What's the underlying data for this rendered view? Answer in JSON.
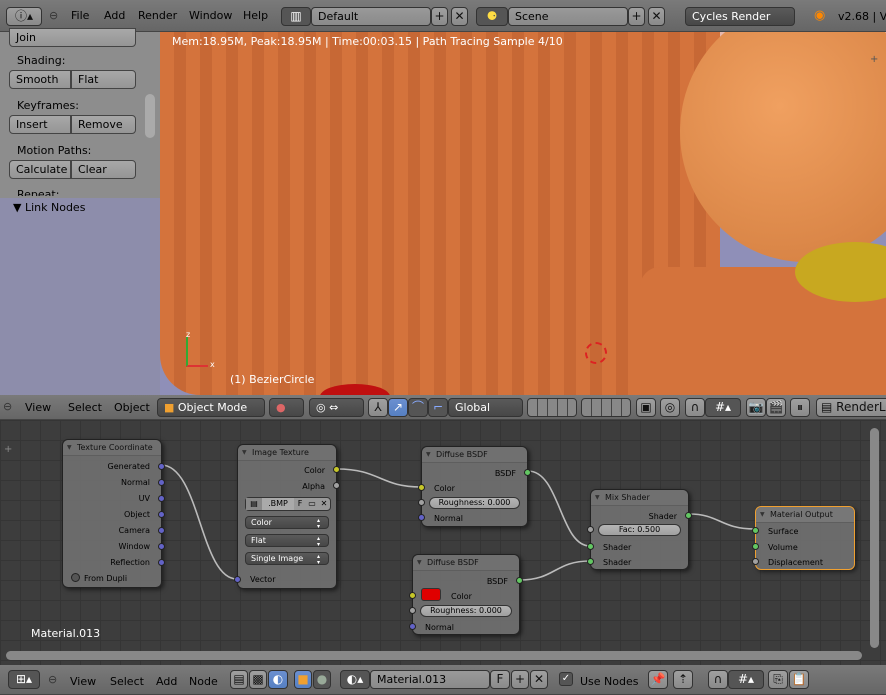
{
  "top_bar": {
    "menus": [
      "File",
      "Add",
      "Render",
      "Window",
      "Help"
    ],
    "layout": "Default",
    "scene": "Scene",
    "engine": "Cycles Render",
    "version": "v2.68 | V"
  },
  "tool_panel": {
    "join": "Join",
    "shading_label": "Shading:",
    "smooth": "Smooth",
    "flat": "Flat",
    "keyframes_label": "Keyframes:",
    "insert": "Insert",
    "remove": "Remove",
    "motion_paths_label": "Motion Paths:",
    "calculate": "Calculate",
    "clear": "Clear",
    "repeat_label": "Repeat:",
    "link_nodes": "Link Nodes"
  },
  "viewport": {
    "stats": "Mem:18.95M, Peak:18.95M | Time:00:03.15 | Path Tracing Sample 4/10",
    "object_label": "(1) BezierCircle",
    "axis_x": "x",
    "axis_z": "z"
  },
  "viewport_header": {
    "menus": [
      "View",
      "Select",
      "Object"
    ],
    "mode": "Object Mode",
    "orientation": "Global",
    "render_layer": "RenderLa"
  },
  "node_editor": {
    "material_label": "Material.013",
    "texture_coordinate": {
      "title": "Texture Coordinate",
      "outputs": [
        "Generated",
        "Normal",
        "UV",
        "Object",
        "Camera",
        "Window",
        "Reflection"
      ],
      "from_dupli": "From Dupli"
    },
    "image_texture": {
      "title": "Image Texture",
      "outputs": [
        "Color",
        "Alpha"
      ],
      "image": ".BMP",
      "f": "F",
      "color_space": "Color",
      "projection": "Flat",
      "source": "Single Image",
      "input": "Vector"
    },
    "diffuse1": {
      "title": "Diffuse BSDF",
      "output": "BSDF",
      "color": "Color",
      "roughness": "Roughness: 0.000",
      "normal": "Normal"
    },
    "diffuse2": {
      "title": "Diffuse BSDF",
      "output": "BSDF",
      "color": "Color",
      "color_value": "#e00000",
      "roughness": "Roughness: 0.000",
      "normal": "Normal"
    },
    "mix": {
      "title": "Mix Shader",
      "output": "Shader",
      "fac": "Fac: 0.500",
      "shader1": "Shader",
      "shader2": "Shader"
    },
    "output": {
      "title": "Material Output",
      "inputs": [
        "Surface",
        "Volume",
        "Displacement"
      ]
    }
  },
  "bottom_bar": {
    "menus": [
      "View",
      "Select",
      "Add",
      "Node"
    ],
    "material": "Material.013",
    "f": "F",
    "use_nodes": "Use Nodes",
    "use_nodes_checked": true
  }
}
